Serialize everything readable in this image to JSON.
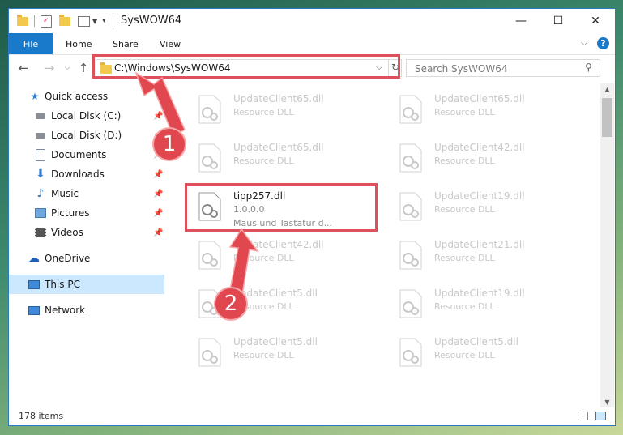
{
  "window": {
    "title": "SysWOW64",
    "controls": {
      "minimize": "—",
      "maximize": "☐",
      "close": "✕"
    }
  },
  "ribbon": {
    "tabs": [
      "File",
      "Home",
      "Share",
      "View"
    ]
  },
  "nav": {
    "address": "C:\\Windows\\SysWOW64",
    "search_placeholder": "Search SysWOW64"
  },
  "sidebar": {
    "items": [
      {
        "label": "Quick access",
        "icon": "star-icon"
      },
      {
        "label": "Local Disk (C:)",
        "icon": "drive-icon",
        "pinned": true
      },
      {
        "label": "Local Disk (D:)",
        "icon": "drive-icon",
        "pinned": true
      },
      {
        "label": "Documents",
        "icon": "documents-icon",
        "pinned": true
      },
      {
        "label": "Downloads",
        "icon": "download-icon",
        "pinned": true
      },
      {
        "label": "Music",
        "icon": "music-icon",
        "pinned": true
      },
      {
        "label": "Pictures",
        "icon": "pictures-icon",
        "pinned": true
      },
      {
        "label": "Videos",
        "icon": "video-icon",
        "pinned": true
      },
      {
        "label": "OneDrive",
        "icon": "cloud-icon"
      },
      {
        "label": "This PC",
        "icon": "computer-icon",
        "selected": true
      },
      {
        "label": "Network",
        "icon": "network-icon"
      }
    ]
  },
  "files": {
    "left": [
      {
        "name": "UpdateClient65.dll",
        "desc": "Resource DLL"
      },
      {
        "name": "UpdateClient65.dll",
        "desc": "Resource DLL"
      },
      {
        "name": "tipp257.dll",
        "version": "1.0.0.0",
        "desc": "Maus und Tastatur d..."
      },
      {
        "name": "UpdateClient42.dll",
        "desc": "Resource DLL"
      },
      {
        "name": "UpdateClient5.dll",
        "desc": "Resource DLL"
      },
      {
        "name": "UpdateClient5.dll",
        "desc": "Resource DLL"
      }
    ],
    "right": [
      {
        "name": "UpdateClient65.dll",
        "desc": "Resource DLL"
      },
      {
        "name": "UpdateClient42.dll",
        "desc": "Resource DLL"
      },
      {
        "name": "UpdateClient19.dll",
        "desc": "Resource DLL"
      },
      {
        "name": "UpdateClient21.dll",
        "desc": "Resource DLL"
      },
      {
        "name": "UpdateClient19.dll",
        "desc": "Resource DLL"
      },
      {
        "name": "UpdateClient5.dll",
        "desc": "Resource DLL"
      }
    ]
  },
  "status": {
    "count": "178 items"
  },
  "annotations": {
    "step1": "1",
    "step2": "2"
  },
  "colors": {
    "accent": "#1979ca",
    "highlight": "#e0505a",
    "selected": "#cce8ff"
  }
}
